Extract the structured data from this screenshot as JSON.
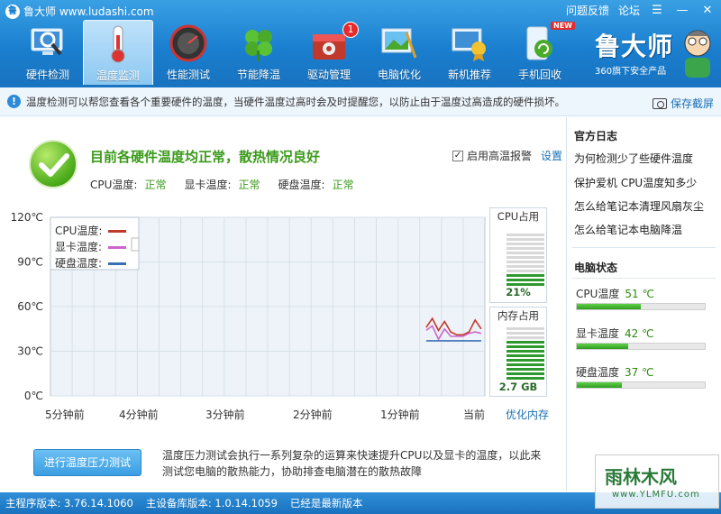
{
  "app": {
    "brand": "鲁大师 www.ludashi.com",
    "feedback": "问题反馈",
    "forum": "论坛"
  },
  "tabs": [
    {
      "label": "硬件检测",
      "icon": "monitor-magnifier-icon"
    },
    {
      "label": "温度监测",
      "icon": "thermometer-icon"
    },
    {
      "label": "性能测试",
      "icon": "speedometer-icon"
    },
    {
      "label": "节能降温",
      "icon": "clover-icon"
    },
    {
      "label": "驱动管理",
      "icon": "toolbox-gear-icon",
      "badge": "1"
    },
    {
      "label": "电脑优化",
      "icon": "landscape-broom-icon"
    },
    {
      "label": "新机推荐",
      "icon": "monitor-award-icon"
    },
    {
      "label": "手机回收",
      "icon": "phone-recycle-icon",
      "badge": "NEW"
    }
  ],
  "logo": {
    "title": "鲁大师",
    "subtitle": "360旗下安全产品"
  },
  "infobar": {
    "text": "温度检测可以帮您查看各个重要硬件的温度，当硬件温度过高时会及时提醒您，以防止由于温度过高造成的硬件损坏。",
    "screenshot": "保存截屏"
  },
  "status": {
    "headline": "目前各硬件温度均正常，散热情况良好",
    "cpu_label": "CPU温度:",
    "cpu_state": "正常",
    "gpu_label": "显卡温度:",
    "gpu_state": "正常",
    "disk_label": "硬盘温度:",
    "disk_state": "正常",
    "alarm_label": "启用高温报警",
    "settings": "设置"
  },
  "chart_data": {
    "type": "line",
    "ylim": [
      0,
      120
    ],
    "y_ticks": [
      "120℃",
      "90℃",
      "60℃",
      "30℃",
      "0℃"
    ],
    "x_ticks": [
      "5分钟前",
      "4分钟前",
      "3分钟前",
      "2分钟前",
      "1分钟前",
      "当前"
    ],
    "legend": [
      {
        "name": "CPU温度:",
        "color": "#c0392b"
      },
      {
        "name": "显卡温度:",
        "color": "#cc66cc"
      },
      {
        "name": "硬盘温度:",
        "color": "#3a6fb5"
      }
    ],
    "series": [
      {
        "name": "CPU温度:",
        "color": "#c0392b",
        "values": [
          46,
          52,
          44,
          50,
          43,
          41,
          41,
          43,
          51,
          45
        ]
      },
      {
        "name": "显卡温度:",
        "color": "#cc66cc",
        "values": [
          44,
          47,
          38,
          45,
          40,
          40,
          40,
          42,
          43,
          42
        ]
      },
      {
        "name": "硬盘温度:",
        "color": "#3a6fb5",
        "values": [
          37,
          37,
          37,
          37,
          37,
          37,
          37,
          37,
          37,
          37
        ]
      }
    ]
  },
  "cpu_usage": {
    "title": "CPU占用",
    "value": "21%",
    "fraction": 0.21
  },
  "memory": {
    "title": "内存占用",
    "value": "2.7 GB",
    "fraction": 0.72,
    "optimize": "优化内存"
  },
  "stress": {
    "button": "进行温度压力测试",
    "desc": "温度压力测试会执行一系列复杂的运算来快速提升CPU以及显卡的温度，以此来测试您电脑的散热能力，协助排查电脑潜在的散热故障"
  },
  "sidebar": {
    "log_title": "官方日志",
    "links": [
      "为何检测少了些硬件温度",
      "保护爱机 CPU温度知多少",
      "怎么给笔记本清理风扇灰尘",
      "怎么给笔记本电脑降温"
    ],
    "state_title": "电脑状态",
    "rows": [
      {
        "label": "CPU温度",
        "value": "51 ℃",
        "fraction": 0.5
      },
      {
        "label": "显卡温度",
        "value": "42 ℃",
        "fraction": 0.4
      },
      {
        "label": "硬盘温度",
        "value": "37 ℃",
        "fraction": 0.35
      }
    ]
  },
  "statusbar": {
    "main_version": "主程序版本: 3.76.14.1060",
    "db_version": "主设备库版本: 1.0.14.1059",
    "latest": "已经是最新版本"
  },
  "watermark": {
    "line1": "雨林木风",
    "line2": "www.YLMFU.com"
  }
}
